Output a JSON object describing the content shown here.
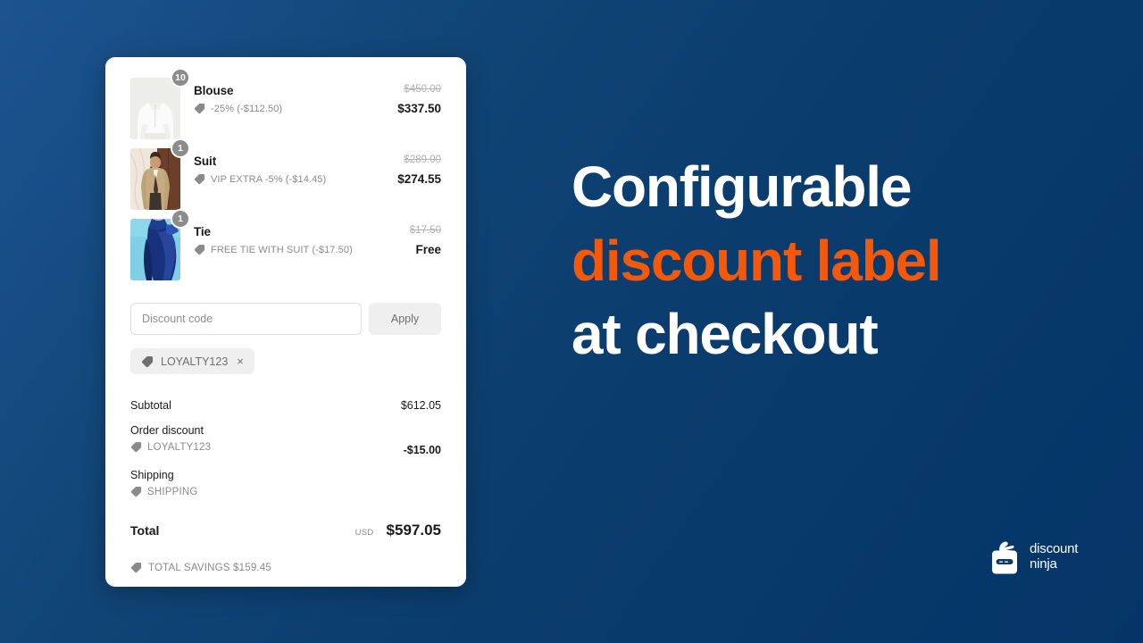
{
  "background": {
    "color_top_left": "#1c5490",
    "color_bottom_right": "#053568"
  },
  "headline": {
    "line1": "Configurable",
    "line2": "discount label",
    "line3": "at checkout",
    "highlight_color": "#f4590b",
    "text_color": "#ffffff"
  },
  "logo": {
    "name_line1": "discount",
    "name_line2": "ninja",
    "icon": "ninja-price-tag-icon"
  },
  "checkout": {
    "items": [
      {
        "name": "Blouse",
        "qty": "10",
        "discount_label": "-25% (-$112.50)",
        "price_original": "$450.00",
        "price_final": "$337.50",
        "thumb": "white-blouse-photo"
      },
      {
        "name": "Suit",
        "qty": "1",
        "discount_label": "VIP EXTRA -5% (-$14.45)",
        "price_original": "$289.00",
        "price_final": "$274.55",
        "thumb": "beige-suit-photo"
      },
      {
        "name": "Tie",
        "qty": "1",
        "discount_label": "FREE TIE WITH SUIT (-$17.50)",
        "price_original": "$17.50",
        "price_final": "Free",
        "thumb": "blue-tie-photo"
      }
    ],
    "discount_code": {
      "placeholder": "Discount code",
      "value": "",
      "apply_label": "Apply",
      "applied_chips": [
        {
          "code": "LOYALTY123",
          "remove_label": "×"
        }
      ]
    },
    "summary": {
      "subtotal_label": "Subtotal",
      "subtotal_value": "$612.05",
      "order_discount_label": "Order discount",
      "order_discount_code": "LOYALTY123",
      "order_discount_value": "-$15.00",
      "shipping_label": "Shipping",
      "shipping_code": "SHIPPING",
      "shipping_value": "",
      "total_label": "Total",
      "total_currency": "USD",
      "total_value": "$597.05",
      "savings_label": "TOTAL SAVINGS $159.45"
    }
  }
}
